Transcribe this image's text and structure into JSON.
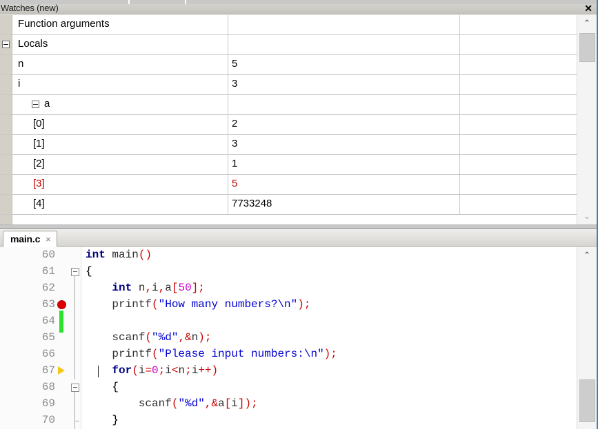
{
  "watches": {
    "title": "Watches (new)",
    "close_label": "✕",
    "scroll_up_icon": "⌃",
    "scroll_down_icon": "⌄",
    "rows": [
      {
        "name": "Function arguments",
        "value": "",
        "indent": 0,
        "expander": "none",
        "changed": false
      },
      {
        "name": "Locals",
        "value": "",
        "indent": 0,
        "expander": "gutter",
        "changed": false
      },
      {
        "name": "n",
        "value": "5",
        "indent": 1,
        "expander": "none",
        "changed": false
      },
      {
        "name": "i",
        "value": "3",
        "indent": 1,
        "expander": "none",
        "changed": false
      },
      {
        "name": "a",
        "value": "",
        "indent": 1,
        "expander": "inline",
        "changed": false
      },
      {
        "name": "[0]",
        "value": "2",
        "indent": 2,
        "expander": "none",
        "changed": false
      },
      {
        "name": "[1]",
        "value": "3",
        "indent": 2,
        "expander": "none",
        "changed": false
      },
      {
        "name": "[2]",
        "value": "1",
        "indent": 2,
        "expander": "none",
        "changed": false
      },
      {
        "name": "[3]",
        "value": "5",
        "indent": 2,
        "expander": "none",
        "changed": true
      },
      {
        "name": "[4]",
        "value": "7733248",
        "indent": 2,
        "expander": "none",
        "changed": false
      }
    ]
  },
  "editor": {
    "tab_label": "main.c",
    "tab_close_label": "×",
    "scroll_up_icon": "⌃",
    "lines": [
      {
        "num": "60",
        "marker": "none",
        "fold": "none"
      },
      {
        "num": "61",
        "marker": "none",
        "fold": "box-start"
      },
      {
        "num": "62",
        "marker": "none",
        "fold": "line"
      },
      {
        "num": "63",
        "marker": "breakpoint",
        "fold": "line"
      },
      {
        "num": "64",
        "marker": "changed",
        "fold": "line"
      },
      {
        "num": "65",
        "marker": "none",
        "fold": "line"
      },
      {
        "num": "66",
        "marker": "none",
        "fold": "line"
      },
      {
        "num": "67",
        "marker": "instruction-pointer",
        "fold": "line-brace"
      },
      {
        "num": "68",
        "marker": "none",
        "fold": "box-inner"
      },
      {
        "num": "69",
        "marker": "none",
        "fold": "line"
      },
      {
        "num": "70",
        "marker": "none",
        "fold": "line-end"
      }
    ],
    "code": [
      "int main()",
      "{",
      "    int n,i,a[50];",
      "    printf(\"How many numbers?\\n\");",
      "",
      "    scanf(\"%d\",&n);",
      "    printf(\"Please input numbers:\\n\");",
      "    for(i=0;i<n;i++)",
      "    {",
      "        scanf(\"%d\",&a[i]);",
      "    }"
    ]
  },
  "colors": {
    "keyword": "#000080",
    "string": "#0000d0",
    "number": "#cc00cc",
    "punctuation": "#cc0000",
    "breakpoint": "#dd0000",
    "change_marker": "#2ee02e",
    "instruction_pointer": "#f5c518",
    "changed_value": "#c00000",
    "window_border": "#4a7ba8"
  }
}
